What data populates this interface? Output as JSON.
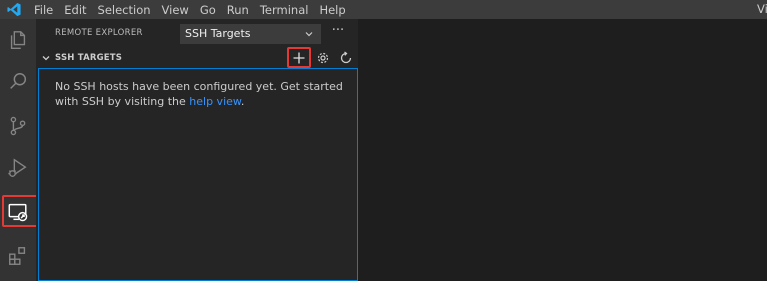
{
  "menu": {
    "items": [
      "File",
      "Edit",
      "Selection",
      "View",
      "Go",
      "Run",
      "Terminal",
      "Help"
    ],
    "window_title_fragment": "Vi"
  },
  "activity_bar": {
    "items": [
      "explorer-icon",
      "search-icon",
      "source-control-icon",
      "run-debug-icon",
      "remote-explorer-icon",
      "extensions-icon"
    ],
    "active": "remote-explorer-icon"
  },
  "sidebar": {
    "title": "REMOTE EXPLORER",
    "select_value": "SSH Targets",
    "more_label": "···",
    "section": {
      "title": "SSH TARGETS",
      "actions": [
        "add-icon",
        "gear-icon",
        "refresh-icon"
      ]
    },
    "message_text": "No SSH hosts have been configured yet. Get started with SSH by visiting the ",
    "message_link": "help view",
    "message_end": "."
  },
  "colors": {
    "accent": "#007fd4",
    "link": "#3794ff",
    "highlight": "#e53935"
  }
}
